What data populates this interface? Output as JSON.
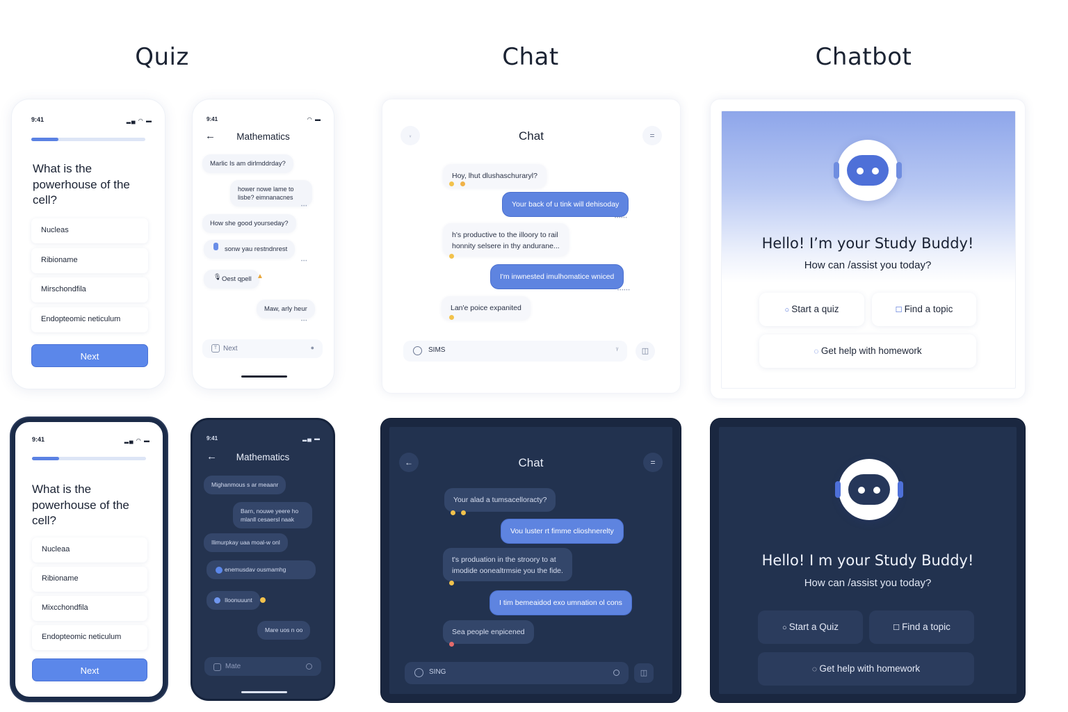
{
  "sections": {
    "quiz": "Quiz",
    "chat": "Chat",
    "chatbot": "Chatbot"
  },
  "quiz_light": {
    "time": "9:41",
    "progress": 0.24,
    "question": "What is the powerhouse of the cell?",
    "options": [
      "Nucleas",
      "Ribioname",
      "Mirschondfila",
      "Endopteomic neticulum"
    ],
    "next": "Next"
  },
  "quiz_dark": {
    "time": "9:41",
    "progress": 0.24,
    "question": "What is the powerhouse of the cell?",
    "options": [
      "Nucleaa",
      "Ribioname",
      "Mixcchondfila",
      "Endopteomic neticulum"
    ],
    "next": "Next"
  },
  "math_light": {
    "time": "9:41",
    "title": "Mathematics",
    "messages": [
      "Marlic Is am dirlmddrday?",
      "hower nowe lame to lisbe? eimnanacnes",
      "How she good yourseday?",
      "sonw yau restndnrest",
      "Oest qpell",
      "Maw, arly heur"
    ],
    "input": "Next"
  },
  "math_dark": {
    "time": "9:41",
    "title": "Mathematics",
    "messages": [
      "Mighanmous s ar meaanr",
      "Barn, nouwe yeere ho mlanll cesaersl naak",
      "Ilimurpkay uaa moal-w onl",
      "enemusdav ousmamhg",
      "Iloonuuunt",
      "Mare uos n oo"
    ],
    "input": "Mate"
  },
  "chat_light": {
    "title": "Chat",
    "messages": [
      "Hoy, lhut dlushaschuraryl?",
      "Your back of u tink will dehisoday",
      "h's productive to the illoory to rail",
      "honnity selsere in thy andurane...",
      "I'm inwnested imulhomatice wniced",
      "Lan'e poice expanited"
    ],
    "input": "SIMS"
  },
  "chat_dark": {
    "title": "Chat",
    "messages": [
      "Your alad a tumsacelloracty?",
      "Vou luster rt fimme clioshnerelty",
      "t's produation in the stroory to at",
      "imodide oonealtrmsie you the fide.",
      "I tim bemeaidod exo umnation ol cons",
      "Sea people enpicened"
    ],
    "input": "SING"
  },
  "chatbot_light": {
    "greeting": "Hello! I’m your Study Buddy!",
    "subtitle": "How can /assist you today?",
    "buttons": {
      "quiz": "Start a quiz",
      "topic": "Find a topic",
      "homework": "Get help with homework"
    }
  },
  "chatbot_dark": {
    "greeting": "Hello! I m your Study Buddy!",
    "subtitle": "How can /assist you today?",
    "buttons": {
      "quiz": "Start a Quiz",
      "topic": "Find a topic",
      "homework": "Get help with homework"
    }
  },
  "colors": {
    "accent": "#5b87ea",
    "dark_bg": "#24334f",
    "text": "#1b2333"
  }
}
